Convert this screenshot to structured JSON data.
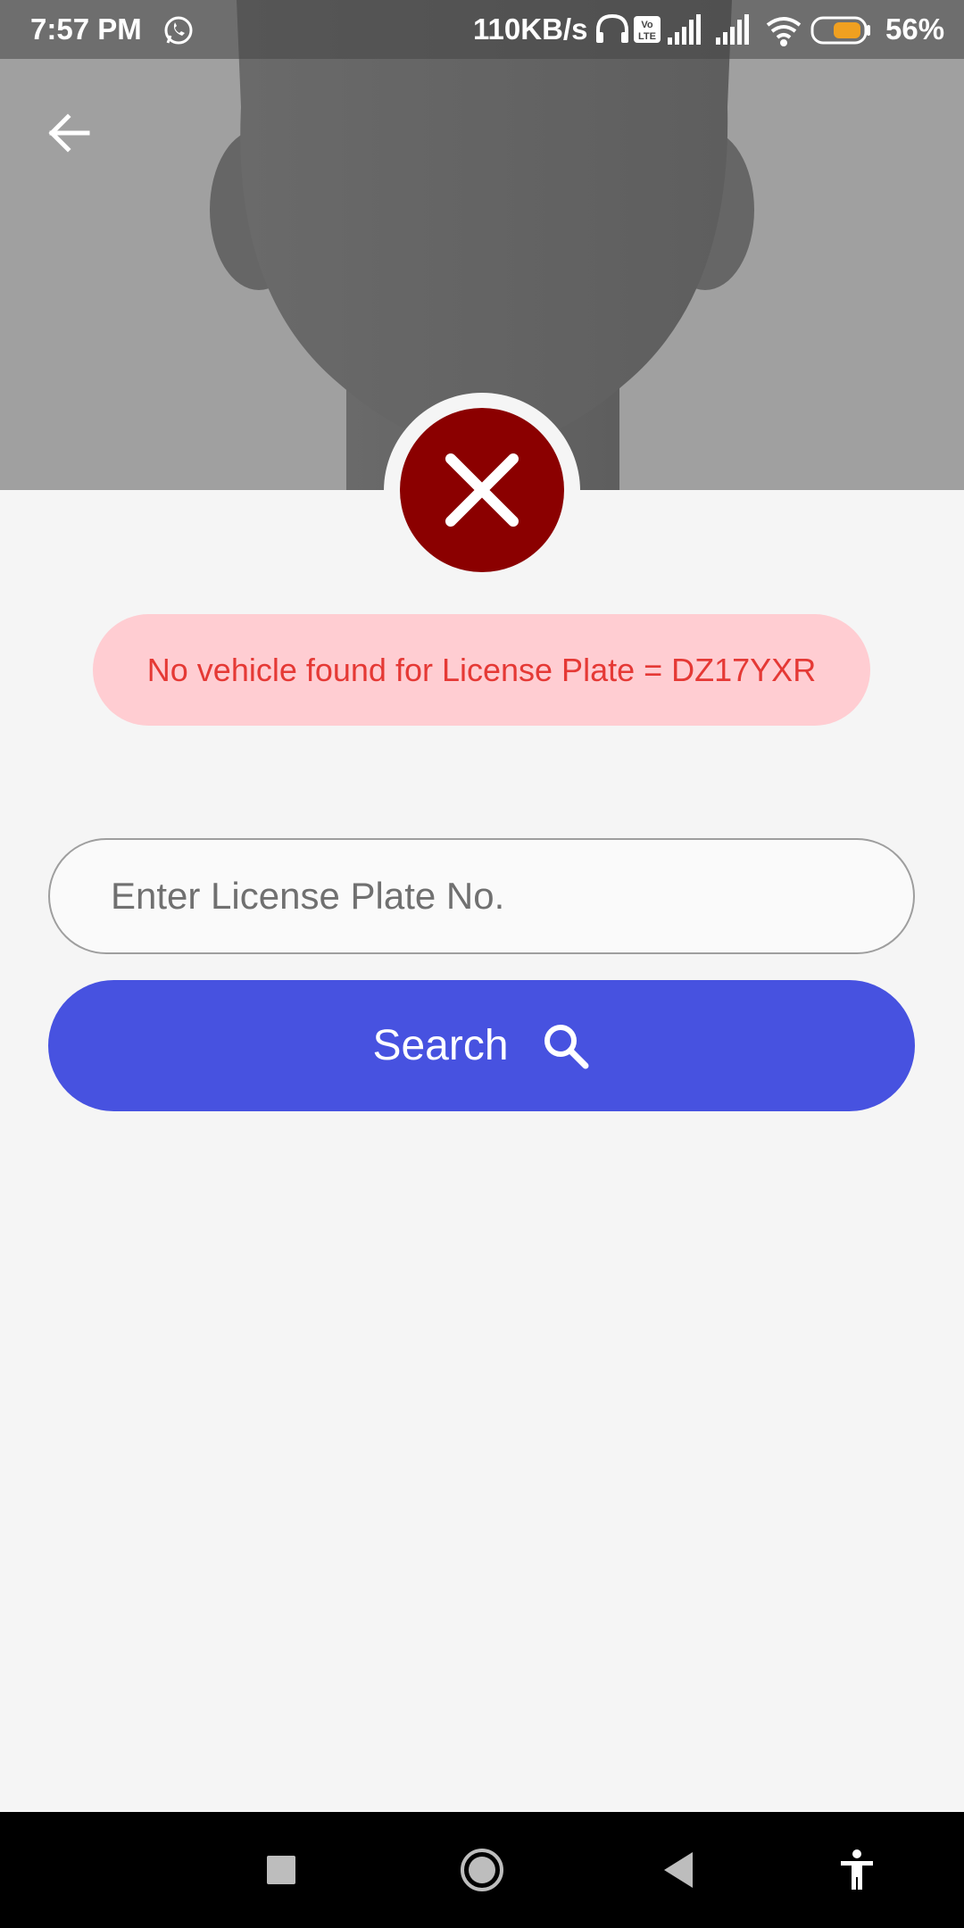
{
  "status_bar": {
    "time": "7:57 PM",
    "network_speed": "110KB/s",
    "battery_percent": "56%",
    "icons": [
      "whatsapp-icon",
      "headset-icon",
      "volte-icon",
      "signal-icon",
      "signal-icon",
      "wifi-icon",
      "battery-icon"
    ]
  },
  "header": {
    "back_icon": "arrow-left-icon"
  },
  "status": {
    "icon": "close-icon",
    "color": "#8b0000",
    "message": "No vehicle found for License Plate = DZ17YXR",
    "message_color": "#e53935",
    "banner_color": "#ffcdd2"
  },
  "search": {
    "placeholder": "Enter License Plate No.",
    "value": "",
    "button_label": "Search",
    "button_icon": "search-icon",
    "button_color": "#4752e0"
  },
  "nav_bar": {
    "items": [
      "recents-icon",
      "home-icon",
      "back-icon",
      "accessibility-icon"
    ]
  }
}
